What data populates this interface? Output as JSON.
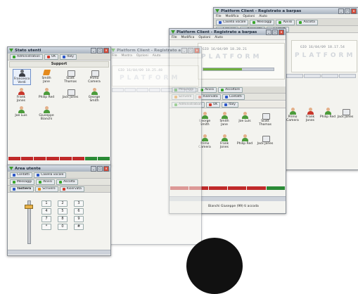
{
  "windows": {
    "w_back": {
      "title": "Platform Client - Registrato a barpas",
      "menu": [
        "File",
        "Modifica",
        "Opzioni",
        "Aiuto"
      ],
      "toolbar": [
        "Casella vocale",
        "Messaggi",
        "Avvisi",
        "Ascolta"
      ],
      "toolbar2": [
        "Scrivere",
        "Riservata",
        "Contatti"
      ],
      "clock": "GIO 16/04/09 18.17.54",
      "brand": "PLATFORM",
      "users": [
        {
          "name": "Primo Camera",
          "icon": "person-icon"
        },
        {
          "name": "Frank Jones",
          "icon": "person-icon"
        },
        {
          "name": "Philip Red",
          "icon": "person-icon"
        },
        {
          "name": "Jack Jones",
          "icon": "phone-icon"
        }
      ]
    },
    "w_mid": {
      "title": "Platform Client - Registrato a barpas",
      "menu": [
        "File",
        "Modifica",
        "Opzioni",
        "Aiuto"
      ],
      "clock": "GIO 16/04/09 18.28.21",
      "brand": "PLATFORM",
      "toolbar": [
        "Messaggi",
        "Avvisi",
        "Ascoltare"
      ],
      "toolbar2": [
        "Scrivere",
        "Riservata",
        "Contatti"
      ],
      "tabs": [
        "Administration",
        "UK",
        "Italy"
      ],
      "users": [
        {
          "name": "George Smith",
          "icon": "person-icon"
        },
        {
          "name": "Smith Jane",
          "icon": "person-icon"
        },
        {
          "name": "Joe Luis",
          "icon": "person-icon"
        },
        {
          "name": "Scott Thomas",
          "icon": "phone-icon"
        },
        {
          "name": "Primo Camera",
          "icon": "person-icon"
        },
        {
          "name": "Frank Jones",
          "icon": "person-icon"
        },
        {
          "name": "Philip Red",
          "icon": "person-icon"
        },
        {
          "name": "Jack Jones",
          "icon": "phone-icon"
        }
      ],
      "status": "Bianchi Giuseppe (99) ti accoda"
    },
    "w_small": {
      "title": "Platform Client - Registrato a ba",
      "menu": [
        "File",
        "Mostra",
        "Opzioni",
        "Aiuto"
      ],
      "clock": "GIO 16/04/09 18.25.48",
      "brand": "PLATFORM"
    },
    "w_left": {
      "title": "Stato utenti",
      "tabs": [
        "Administration",
        "UK",
        "Italy"
      ],
      "group": "Support",
      "users": [
        {
          "name": "Francesco Verdi",
          "icon": "dark-person-icon",
          "selected": true
        },
        {
          "name": "Smith Jane",
          "icon": "orange-icon"
        },
        {
          "name": "Scott Thomas",
          "icon": "phone-icon"
        },
        {
          "name": "Primo Camera",
          "icon": "phone-icon"
        },
        {
          "name": "Frank Jones",
          "icon": "red-person-icon"
        },
        {
          "name": "Philip Red",
          "icon": "person-icon"
        },
        {
          "name": "Jack Jones",
          "icon": "phone-icon"
        },
        {
          "name": "George Smith",
          "icon": "person-icon"
        },
        {
          "name": "Joe Luis",
          "icon": "person-icon"
        },
        {
          "name": "Giuseppe Bianchi",
          "icon": "person-icon"
        }
      ]
    },
    "w_dial": {
      "title": "Area utente",
      "row1": [
        "Contatti",
        "Casella vocale"
      ],
      "row2": [
        "Messaggi",
        "Avvisi",
        "Ascolta"
      ],
      "row3": [
        "Tastiera",
        "Scrivere",
        "Riservata"
      ],
      "keys": [
        "1",
        "2",
        "3",
        "4",
        "5",
        "6",
        "7",
        "8",
        "9",
        "*",
        "0",
        "#"
      ]
    }
  }
}
